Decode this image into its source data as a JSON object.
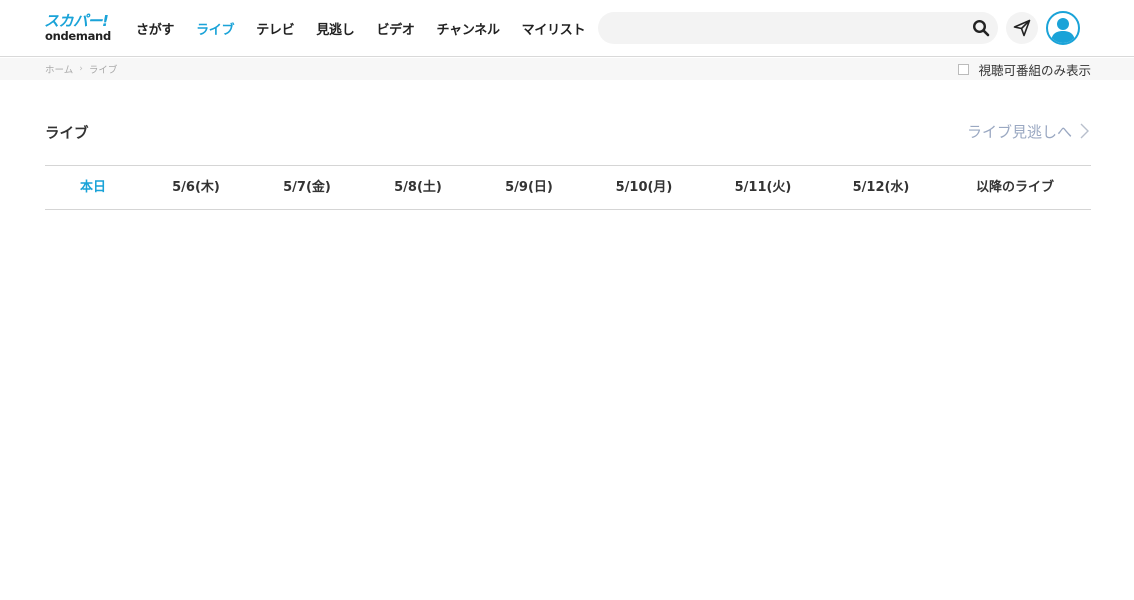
{
  "header": {
    "logo": {
      "top": "スカパー!",
      "bottom": "ondemand"
    },
    "nav": [
      {
        "label": "さがす",
        "active": false
      },
      {
        "label": "ライブ",
        "active": true
      },
      {
        "label": "テレビ",
        "active": false
      },
      {
        "label": "見逃し",
        "active": false
      },
      {
        "label": "ビデオ",
        "active": false
      },
      {
        "label": "チャンネル",
        "active": false
      },
      {
        "label": "マイリスト",
        "active": false
      }
    ],
    "search": {
      "value": "",
      "placeholder": "",
      "icon": "search-icon"
    },
    "send_icon": "paper-plane-icon",
    "avatar_icon": "user-avatar-icon"
  },
  "breadcrumb": [
    "ホーム",
    "ライブ"
  ],
  "filter": {
    "label": "視聴可番組のみ表示",
    "checked": false
  },
  "main": {
    "title": "ライブ",
    "missed_link": "ライブ見逃しへ",
    "date_tabs": [
      {
        "label": "本日",
        "active": true
      },
      {
        "label": "5/6(木)",
        "active": false
      },
      {
        "label": "5/7(金)",
        "active": false
      },
      {
        "label": "5/8(土)",
        "active": false
      },
      {
        "label": "5/9(日)",
        "active": false
      },
      {
        "label": "5/10(月)",
        "active": false
      },
      {
        "label": "5/11(火)",
        "active": false
      },
      {
        "label": "5/12(水)",
        "active": false
      },
      {
        "label": "以降のライブ",
        "active": false
      }
    ]
  },
  "colors": {
    "accent": "#1aa3d8",
    "link_muted": "#9aa8c2",
    "divider": "#d5d5d5"
  }
}
